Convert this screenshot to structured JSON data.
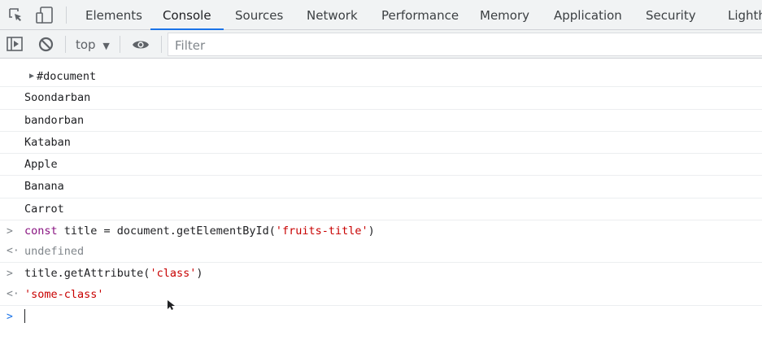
{
  "tabs": [
    "Elements",
    "Console",
    "Sources",
    "Network",
    "Performance",
    "Memory",
    "Application",
    "Security",
    "Lighth"
  ],
  "active_tab": "Console",
  "toolbar": {
    "context": "top",
    "filter_placeholder": "Filter"
  },
  "console": {
    "document_node": "#document",
    "logs": [
      "Soondarban",
      "bandorban",
      "Kataban",
      "Apple",
      "Banana",
      "Carrot"
    ],
    "cmd1": {
      "kw": "const",
      "code": " title = document.getElementById(",
      "str": "'fruits-title'",
      "end": ")"
    },
    "result1": "undefined",
    "cmd2": {
      "code": "title.getAttribute(",
      "str": "'class'",
      "end": ")"
    },
    "result2": "'some-class'"
  }
}
